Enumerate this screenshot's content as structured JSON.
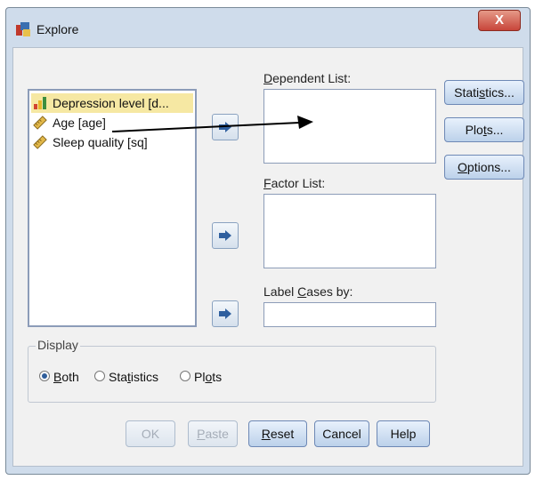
{
  "window": {
    "title": "Explore",
    "close_label": "X"
  },
  "variables": [
    {
      "label": "Depression level [d...",
      "type": "ordinal",
      "icon": "ordinal-bar-icon",
      "selected": true
    },
    {
      "label": "Age [age]",
      "type": "scale",
      "icon": "scale-ruler-icon",
      "selected": false
    },
    {
      "label": "Sleep quality [sq]",
      "type": "scale",
      "icon": "scale-ruler-icon",
      "selected": false
    }
  ],
  "dependent_list": {
    "pre": "",
    "ul": "D",
    "post": "ependent List:"
  },
  "factor_list": {
    "pre": "",
    "ul": "F",
    "post": "actor List:"
  },
  "label_cases": {
    "pre": "Label ",
    "ul": "C",
    "post": "ases by:"
  },
  "side_buttons": [
    {
      "pre": "Stati",
      "ul": "s",
      "post": "tics..."
    },
    {
      "pre": "Plo",
      "ul": "t",
      "post": "s..."
    },
    {
      "pre": "",
      "ul": "O",
      "post": "ptions..."
    }
  ],
  "display": {
    "legend": "Display",
    "options": [
      {
        "pre": "",
        "ul": "B",
        "post": "oth",
        "checked": true
      },
      {
        "pre": "Sta",
        "ul": "t",
        "post": "istics",
        "checked": false
      },
      {
        "pre": "Pl",
        "ul": "o",
        "post": "ts",
        "checked": false
      }
    ]
  },
  "bottom_buttons": [
    {
      "pre": "",
      "ul": "",
      "post": "OK",
      "enabled": false
    },
    {
      "pre": "",
      "ul": "P",
      "post": "aste",
      "enabled": false
    },
    {
      "pre": "",
      "ul": "R",
      "post": "eset",
      "enabled": true
    },
    {
      "pre": "",
      "ul": "",
      "post": "Cancel",
      "enabled": true
    },
    {
      "pre": "",
      "ul": "",
      "post": "Help",
      "enabled": true
    }
  ],
  "colors": {
    "selection_highlight": "#f6e8a3",
    "arrow_button_glyph": "#2f5f9e",
    "close_button": "#c8453a"
  }
}
